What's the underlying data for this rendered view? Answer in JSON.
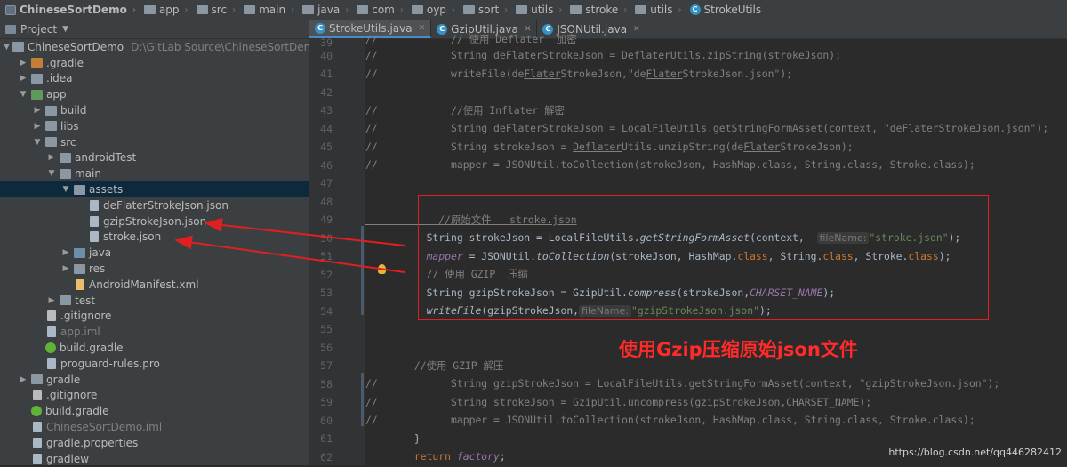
{
  "breadcrumb": [
    {
      "label": "ChineseSortDemo",
      "icon": "module-icon"
    },
    {
      "label": "app",
      "icon": "folder-icon"
    },
    {
      "label": "src",
      "icon": "folder-icon"
    },
    {
      "label": "main",
      "icon": "folder-icon"
    },
    {
      "label": "java",
      "icon": "folder-icon"
    },
    {
      "label": "com",
      "icon": "folder-icon"
    },
    {
      "label": "oyp",
      "icon": "folder-icon"
    },
    {
      "label": "sort",
      "icon": "folder-icon"
    },
    {
      "label": "utils",
      "icon": "folder-icon"
    },
    {
      "label": "stroke",
      "icon": "folder-icon"
    },
    {
      "label": "utils",
      "icon": "folder-icon"
    },
    {
      "label": "StrokeUtils",
      "icon": "class-icon"
    }
  ],
  "project_panel": {
    "title": "Project",
    "root": {
      "name": "ChineseSortDemo",
      "path": "D:\\GitLab Source\\ChineseSortDemo"
    },
    "items": [
      {
        "label": ".gradle"
      },
      {
        "label": ".idea"
      },
      {
        "label": "app"
      },
      {
        "label": "build"
      },
      {
        "label": "libs"
      },
      {
        "label": "src"
      },
      {
        "label": "androidTest"
      },
      {
        "label": "main"
      },
      {
        "label": "assets"
      },
      {
        "label": "deFlaterStrokeJson.json"
      },
      {
        "label": "gzipStrokeJson.json"
      },
      {
        "label": "stroke.json"
      },
      {
        "label": "java"
      },
      {
        "label": "res"
      },
      {
        "label": "AndroidManifest.xml"
      },
      {
        "label": "test"
      },
      {
        "label": ".gitignore"
      },
      {
        "label": "app.iml"
      },
      {
        "label": "build.gradle"
      },
      {
        "label": "proguard-rules.pro"
      },
      {
        "label": "gradle"
      },
      {
        "label": ".gitignore"
      },
      {
        "label": "build.gradle"
      },
      {
        "label": "ChineseSortDemo.iml"
      },
      {
        "label": "gradle.properties"
      },
      {
        "label": "gradlew"
      }
    ]
  },
  "tabs": [
    {
      "label": "StrokeUtils.java",
      "active": true
    },
    {
      "label": "GzipUtil.java",
      "active": false
    },
    {
      "label": "JSONUtil.java",
      "active": false
    }
  ],
  "line_numbers": [
    "39",
    "40",
    "41",
    "42",
    "43",
    "44",
    "45",
    "46",
    "47",
    "48",
    "49",
    "50",
    "51",
    "52",
    "53",
    "54",
    "55",
    "56",
    "57",
    "58",
    "59",
    "60",
    "61",
    "62"
  ],
  "code": {
    "l39": "//            // 使用 Deflater  加密",
    "l40a": "//            String de",
    "l40b": "Flater",
    "l40c": "StrokeJson = ",
    "l40d": "Deflater",
    "l40e": "Utils.zipString(strokeJson);",
    "l41a": "//            writeFile(de",
    "l41b": "Flater",
    "l41c": "StrokeJson,\"de",
    "l41d": "Flater",
    "l41e": "StrokeJson.json\");",
    "l43": "//            //使用 Inflater 解密",
    "l44a": "//            String de",
    "l44b": "Flater",
    "l44c": "StrokeJson = LocalFileUtils.getStringFormAsset(context, \"de",
    "l44d": "Flater",
    "l44e": "StrokeJson.json\");",
    "l45a": "//            String strokeJson = ",
    "l45b": "Deflater",
    "l45c": "Utils.unzipString(de",
    "l45d": "Flater",
    "l45e": "StrokeJson);",
    "l46": "//            mapper = JSONUtil.toCollection(strokeJson, HashMap.class, String.class, Stroke.class);",
    "l49": "            //原始文件   stroke.json",
    "l50a": "          String strokeJson = LocalFileUtils.",
    "l50b": "getStringFormAsset",
    "l50c": "(context, ",
    "l50hint": "fileName:",
    "l50d": "\"stroke.json\"",
    "l50e": ");",
    "l51a": "mapper",
    "l51b": " = JSONUtil.",
    "l51c": "toCollection",
    "l51d": "(strokeJson, HashMap.",
    "l51e": "class",
    "l51f": ", String.",
    "l51g": "class",
    "l51h": ", Stroke.",
    "l51i": "class",
    "l51j": ");",
    "l52": "          // 使用 GZIP  压缩",
    "l53a": "          String gzipStrokeJson = GzipUtil.",
    "l53b": "compress",
    "l53c": "(strokeJson,",
    "l53d": "CHARSET_NAME",
    "l53e": ");",
    "l54a": "writeFile",
    "l54b": "(gzipStrokeJson,",
    "l54hint": "fileName:",
    "l54c": "\"gzipStrokeJson.json\"",
    "l54d": ");",
    "l57": "        //使用 GZIP 解压",
    "l58": "//            String gzipStrokeJson = LocalFileUtils.getStringFormAsset(context, \"gzipStrokeJson.json\");",
    "l59": "//            String strokeJson = GzipUtil.uncompress(gzipStrokeJson,CHARSET_NAME);",
    "l60": "//            mapper = JSONUtil.toCollection(strokeJson, HashMap.class, String.class, Stroke.class);",
    "l61": "        }",
    "l62a": "        return ",
    "l62b": "factory",
    "l62c": ";"
  },
  "annotation": "使用Gzip压缩原始json文件",
  "watermark": "https://blog.csdn.net/qq446282412",
  "colors": {
    "annotation": "#ff2a2a",
    "box": "#e02020",
    "keyword": "#cc7832",
    "string": "#6a8759",
    "comment": "#808080"
  }
}
